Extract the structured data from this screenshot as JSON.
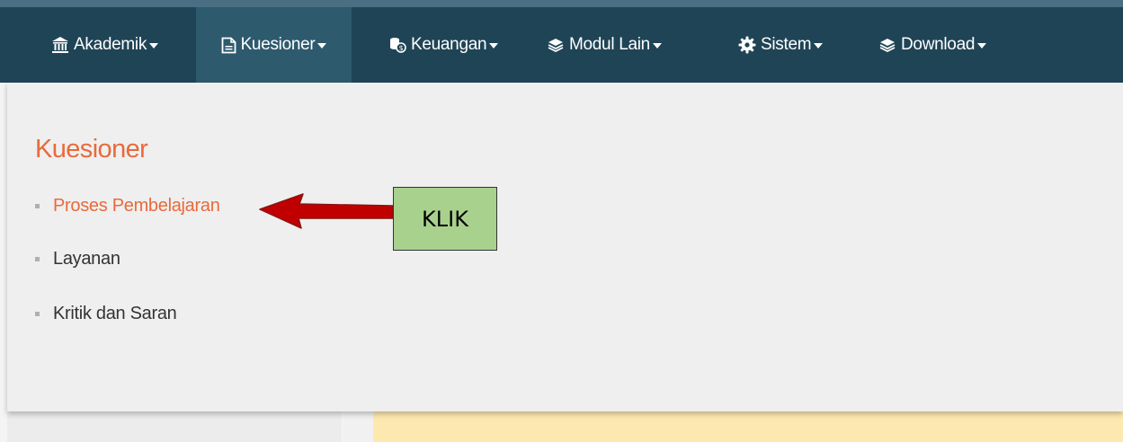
{
  "navbar": {
    "items": [
      {
        "label": "Akademik",
        "icon": "bank-icon"
      },
      {
        "label": "Kuesioner",
        "icon": "file-icon",
        "active": true
      },
      {
        "label": "Keuangan",
        "icon": "coins-icon"
      },
      {
        "label": "Modul Lain",
        "icon": "layers-icon"
      },
      {
        "label": "Sistem",
        "icon": "gear-icon"
      },
      {
        "label": "Download",
        "icon": "layers-icon"
      }
    ]
  },
  "dropdown": {
    "heading": "Kuesioner",
    "items": [
      {
        "label": "Proses Pembelajaran",
        "highlighted": true
      },
      {
        "label": "Layanan"
      },
      {
        "label": "Kritik dan Saran"
      }
    ]
  },
  "annotation": {
    "label": "KLIK"
  },
  "colors": {
    "navbar_bg": "#1f4456",
    "accent_orange": "#e86a3c",
    "annotation_box": "#a9d18e",
    "arrow_red": "#c00000"
  }
}
